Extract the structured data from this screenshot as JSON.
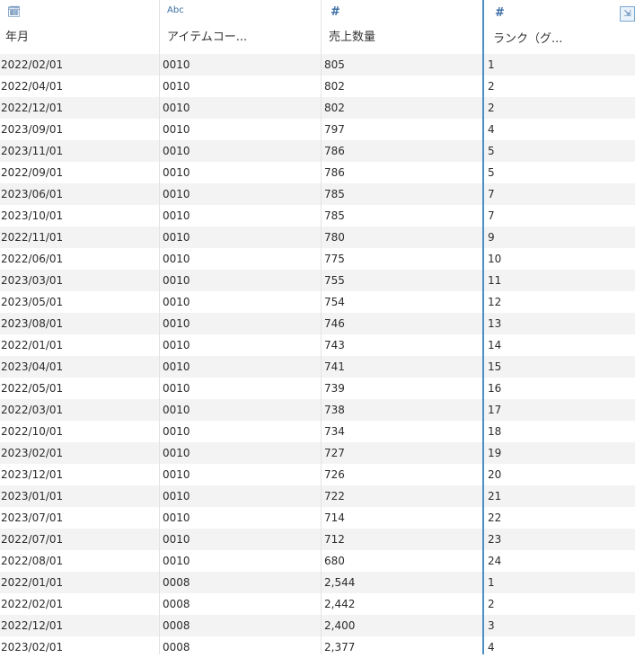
{
  "columns": [
    {
      "type_icon": "calendar-icon",
      "type_glyph": "🗓",
      "title": "年月"
    },
    {
      "type_icon": "string-type-icon",
      "type_glyph": "Abc",
      "title": "アイテムコー..."
    },
    {
      "type_icon": "number-type-icon",
      "type_glyph": "#",
      "title": "売上数量"
    },
    {
      "type_icon": "number-type-icon",
      "type_glyph": "#",
      "title": "ランク（グ..."
    }
  ],
  "corner_button": {
    "icon": "column-menu-icon",
    "glyph": "⇲"
  },
  "rows": [
    [
      "2022/02/01",
      "0010",
      "805",
      "1"
    ],
    [
      "2022/04/01",
      "0010",
      "802",
      "2"
    ],
    [
      "2022/12/01",
      "0010",
      "802",
      "2"
    ],
    [
      "2023/09/01",
      "0010",
      "797",
      "4"
    ],
    [
      "2023/11/01",
      "0010",
      "786",
      "5"
    ],
    [
      "2022/09/01",
      "0010",
      "786",
      "5"
    ],
    [
      "2023/06/01",
      "0010",
      "785",
      "7"
    ],
    [
      "2023/10/01",
      "0010",
      "785",
      "7"
    ],
    [
      "2022/11/01",
      "0010",
      "780",
      "9"
    ],
    [
      "2022/06/01",
      "0010",
      "775",
      "10"
    ],
    [
      "2023/03/01",
      "0010",
      "755",
      "11"
    ],
    [
      "2023/05/01",
      "0010",
      "754",
      "12"
    ],
    [
      "2023/08/01",
      "0010",
      "746",
      "13"
    ],
    [
      "2022/01/01",
      "0010",
      "743",
      "14"
    ],
    [
      "2023/04/01",
      "0010",
      "741",
      "15"
    ],
    [
      "2022/05/01",
      "0010",
      "739",
      "16"
    ],
    [
      "2022/03/01",
      "0010",
      "738",
      "17"
    ],
    [
      "2022/10/01",
      "0010",
      "734",
      "18"
    ],
    [
      "2023/02/01",
      "0010",
      "727",
      "19"
    ],
    [
      "2023/12/01",
      "0010",
      "726",
      "20"
    ],
    [
      "2023/01/01",
      "0010",
      "722",
      "21"
    ],
    [
      "2023/07/01",
      "0010",
      "714",
      "22"
    ],
    [
      "2022/07/01",
      "0010",
      "712",
      "23"
    ],
    [
      "2022/08/01",
      "0010",
      "680",
      "24"
    ],
    [
      "2022/01/01",
      "0008",
      "2,544",
      "1"
    ],
    [
      "2022/02/01",
      "0008",
      "2,442",
      "2"
    ],
    [
      "2022/12/01",
      "0008",
      "2,400",
      "3"
    ],
    [
      "2023/02/01",
      "0008",
      "2,377",
      "4"
    ]
  ]
}
